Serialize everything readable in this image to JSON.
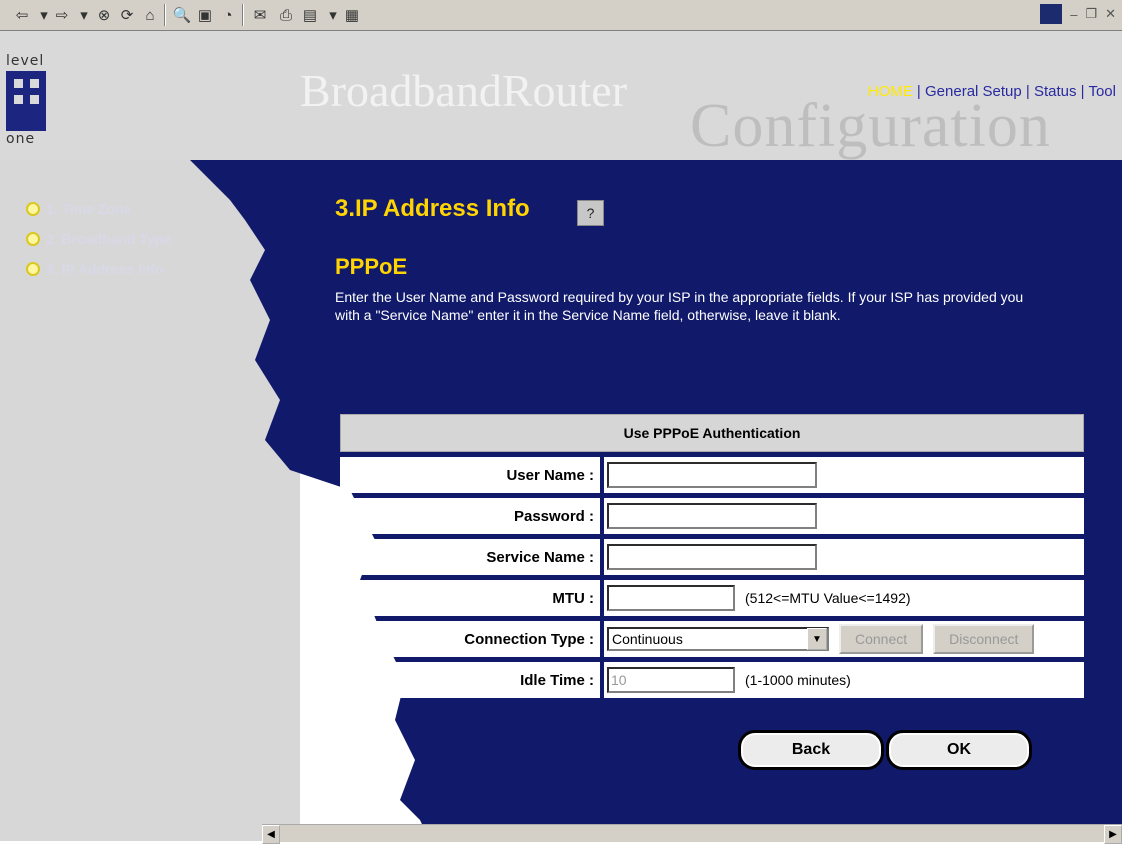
{
  "toolbar": {
    "icons": [
      "back-icon",
      "forward-icon",
      "stop-icon",
      "refresh-icon",
      "home-icon",
      "search-icon",
      "favorites-icon",
      "history-icon",
      "mail-icon",
      "print-icon",
      "edit-icon",
      "discuss-icon"
    ],
    "window_controls": [
      "_",
      "̅",
      "×"
    ]
  },
  "header": {
    "logo_top": "level",
    "logo_bottom": "one",
    "brand_title": "BroadbandRouter",
    "brand_sub": "Configuration",
    "nav": {
      "home": "HOME",
      "general": "General Setup",
      "status": "Status",
      "tool": "Tool",
      "sep": " | "
    }
  },
  "sidebar": {
    "steps": [
      "1. Time Zone",
      "2. Broadband Type",
      "3. IP Address Info"
    ]
  },
  "main": {
    "title": "3.IP Address Info",
    "help": "?",
    "section": "PPPoE",
    "description": "Enter the User Name and Password required by your ISP in the appropriate fields. If your ISP has provided you with a \"Service Name\" enter it in the Service Name field, otherwise, leave it blank."
  },
  "form": {
    "heading": "Use PPPoE Authentication",
    "user_name": {
      "label": "User Name :",
      "value": ""
    },
    "password": {
      "label": "Password :",
      "value": ""
    },
    "service_name": {
      "label": "Service Name :",
      "value": ""
    },
    "mtu": {
      "label": "MTU :",
      "value": "",
      "hint": "(512<=MTU Value<=1492)"
    },
    "connection_type": {
      "label": "Connection Type :",
      "value": "Continuous",
      "connect": "Connect",
      "disconnect": "Disconnect"
    },
    "idle_time": {
      "label": "Idle Time :",
      "value": "10",
      "hint": "(1-1000 minutes)"
    }
  },
  "buttons": {
    "back": "Back",
    "ok": "OK"
  },
  "colors": {
    "navy": "#10196a",
    "yellow": "#ffd400",
    "gray": "#d7d7d7"
  }
}
